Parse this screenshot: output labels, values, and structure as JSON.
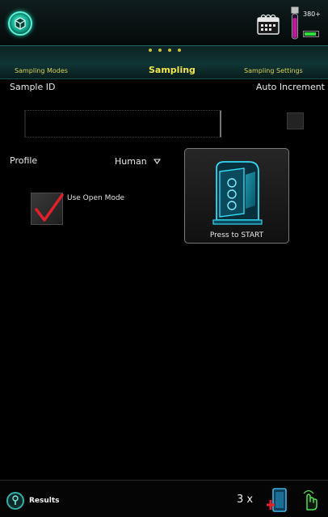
{
  "header": {
    "home_icon": "cube-home-icon",
    "calendar_icon": "calendar-icon",
    "tube_icon": "sample-tube-icon",
    "tube_count": "380+",
    "battery_level": 0.85
  },
  "tabs": {
    "page_dots": 4,
    "left_label": "Sampling Modes",
    "active_label": "Sampling",
    "right_label": "Sampling Settings"
  },
  "sample": {
    "id_label": "Sample ID",
    "id_value": "",
    "auto_increment_label": "Auto Increment",
    "auto_increment_checked": false
  },
  "profile": {
    "label": "Profile",
    "value": "Human"
  },
  "open_mode": {
    "label": "Use Open Mode",
    "checked": true
  },
  "start": {
    "label": "Press to START",
    "icon": "analyzer-icon"
  },
  "footer": {
    "results_label": "Results",
    "multiplier": "3 x",
    "rack_icon": "tube-rack-icon",
    "touch_icon": "touch-hand-icon"
  },
  "colors": {
    "accent": "#f2e64a",
    "teal": "#1fd4b0",
    "check": "#e0202a",
    "battery": "#2de03a"
  }
}
